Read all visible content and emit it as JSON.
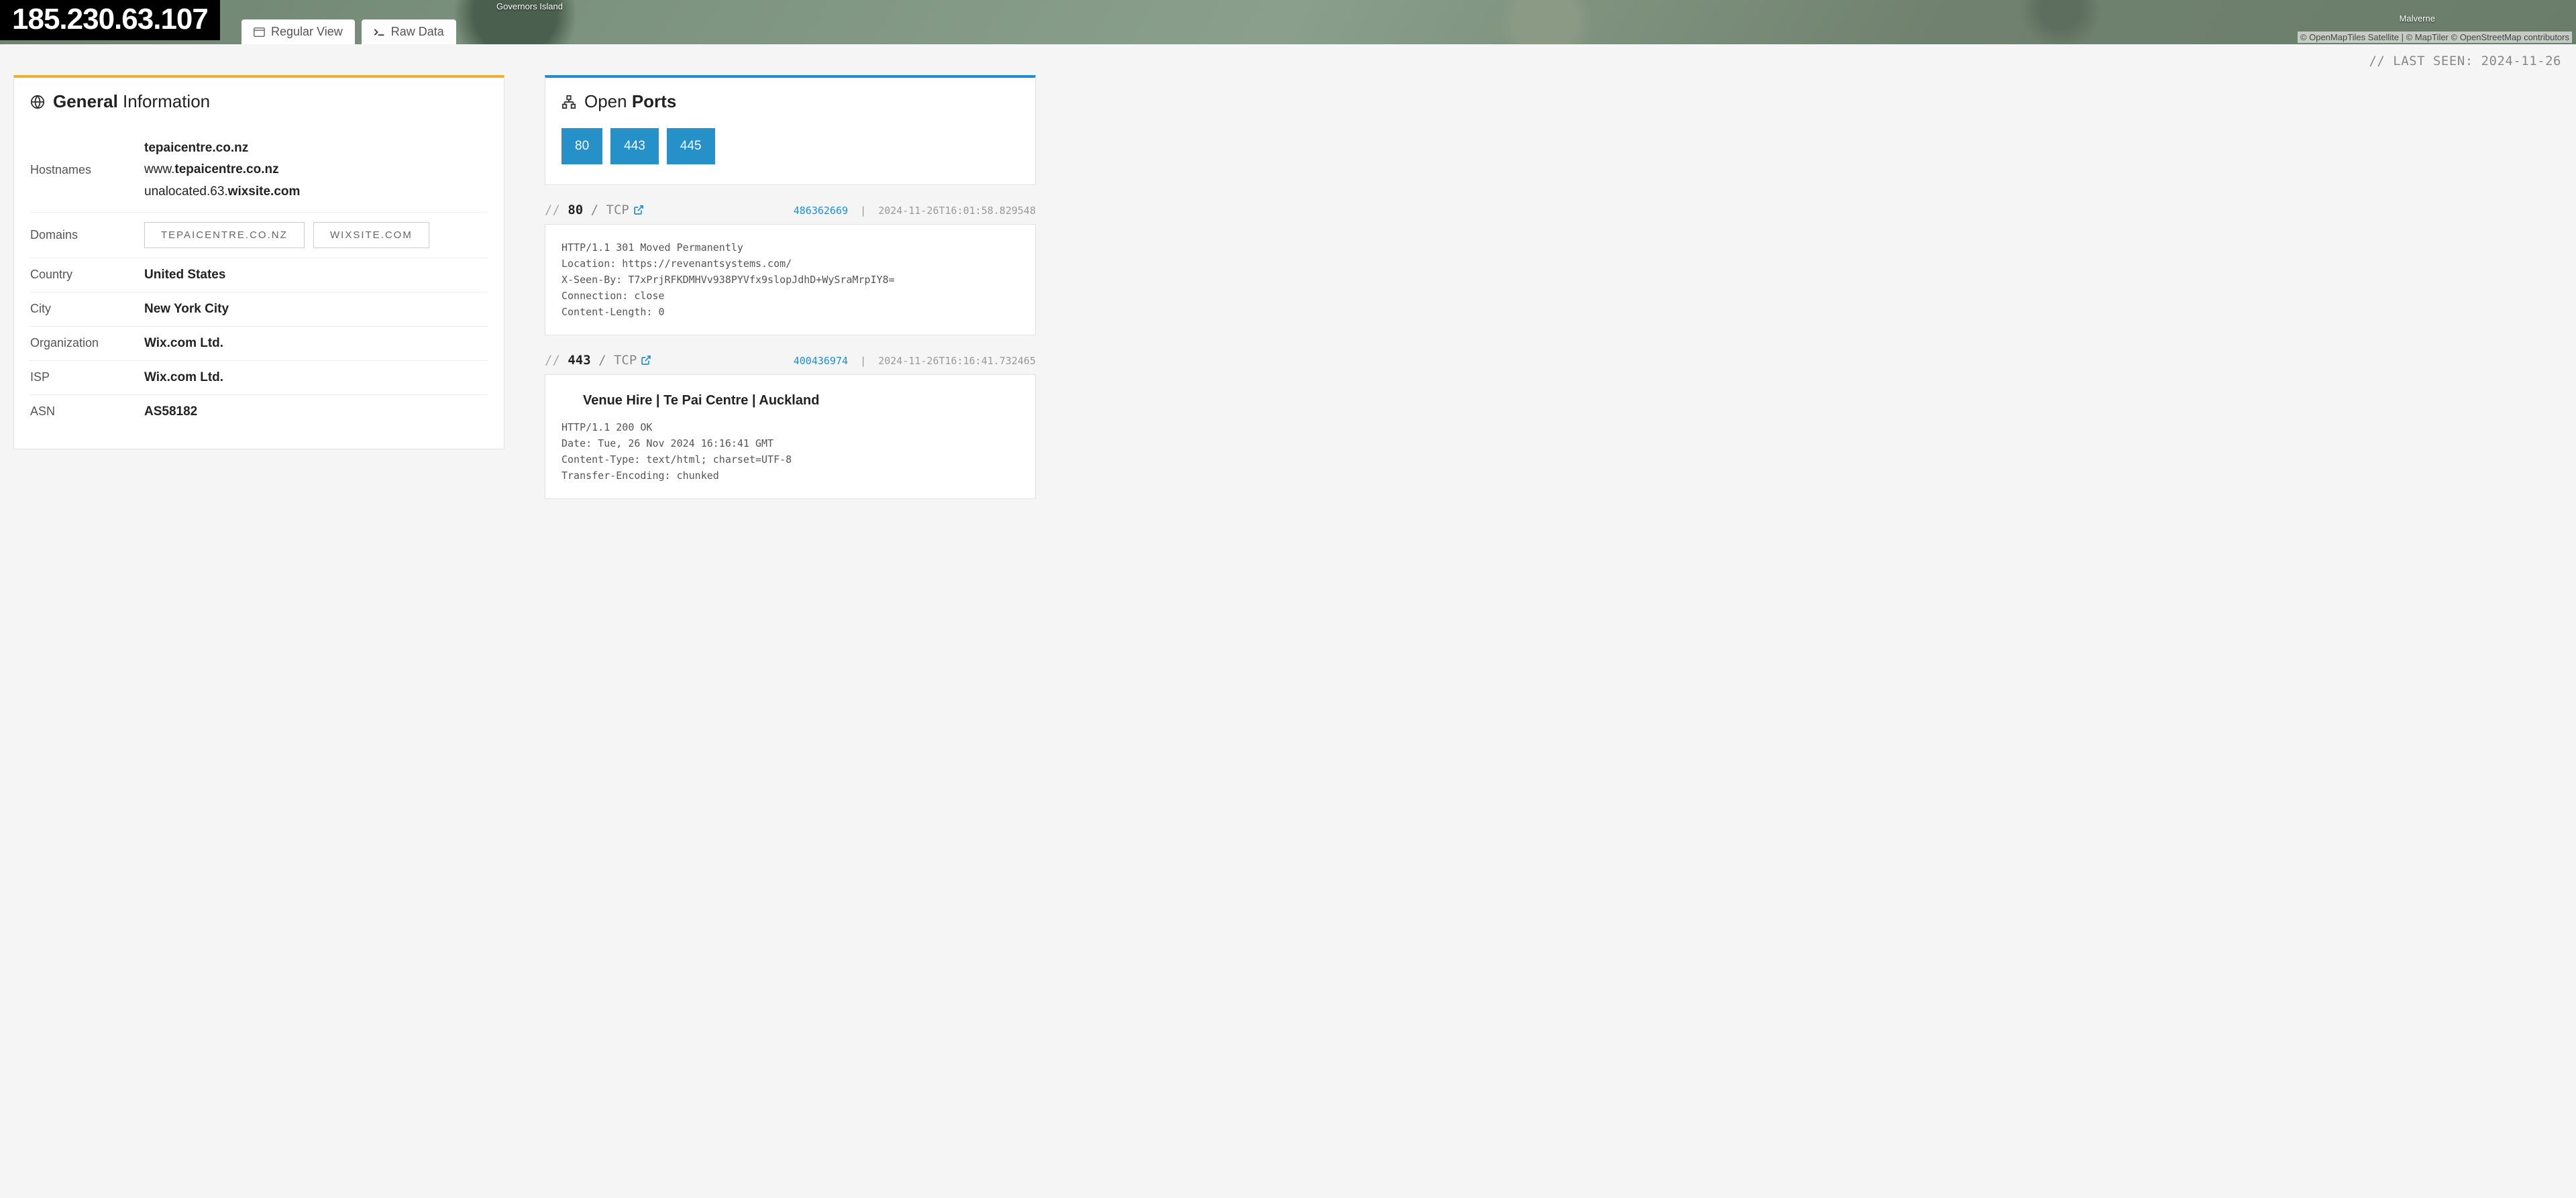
{
  "ip": "185.230.63.107",
  "map": {
    "label_gov": "Governors Island",
    "label_mal": "Malverne",
    "attrib": "© OpenMapTiles Satellite | © MapTiler © OpenStreetMap contributors"
  },
  "tabs": {
    "regular": "Regular View",
    "raw": "Raw Data"
  },
  "last_seen_label": "// LAST SEEN: 2024-11-26",
  "general": {
    "title_bold": "General",
    "title_rest": " Information",
    "rows": {
      "hostnames_label": "Hostnames",
      "hostnames": [
        "tepaicentre.co.nz",
        "www.tepaicentre.co.nz",
        "unalocated.63.wixsite.com"
      ],
      "domains_label": "Domains",
      "domains": [
        "TEPAICENTRE.CO.NZ",
        "WIXSITE.COM"
      ],
      "country_label": "Country",
      "country": "United States",
      "city_label": "City",
      "city": "New York City",
      "org_label": "Organization",
      "org": "Wix.com Ltd.",
      "isp_label": "ISP",
      "isp": "Wix.com Ltd.",
      "asn_label": "ASN",
      "asn": "AS58182"
    }
  },
  "open_ports": {
    "title_prefix": "Open ",
    "title_bold": "Ports",
    "ports": [
      "80",
      "443",
      "445"
    ]
  },
  "services": [
    {
      "port": "80",
      "proto": "TCP",
      "hash": "486362669",
      "timestamp": "2024-11-26T16:01:58.829548",
      "banner_title": "",
      "raw": "HTTP/1.1 301 Moved Permanently\nLocation: https://revenantsystems.com/\nX-Seen-By: T7xPrjRFKDMHVv938PYVfx9slopJdhD+WySraMrpIY8=\nConnection: close\nContent-Length: 0"
    },
    {
      "port": "443",
      "proto": "TCP",
      "hash": "400436974",
      "timestamp": "2024-11-26T16:16:41.732465",
      "banner_title": "Venue Hire | Te Pai Centre | Auckland",
      "raw": "HTTP/1.1 200 OK\nDate: Tue, 26 Nov 2024 16:16:41 GMT\nContent-Type: text/html; charset=UTF-8\nTransfer-Encoding: chunked"
    }
  ]
}
